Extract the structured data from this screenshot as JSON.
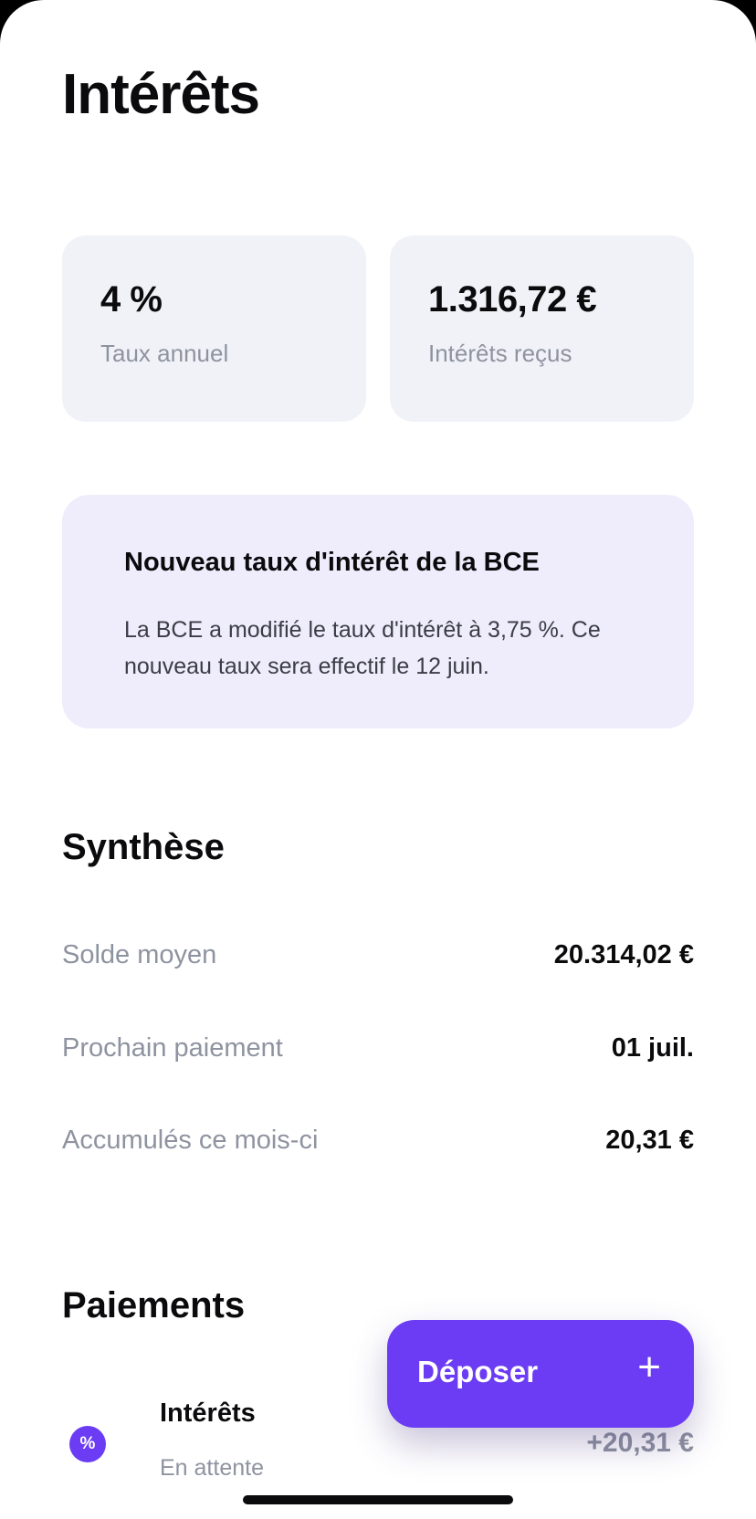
{
  "header": {
    "title": "Intérêts"
  },
  "stats": [
    {
      "value": "4 %",
      "label": "Taux annuel"
    },
    {
      "value": "1.316,72 €",
      "label": "Intérêts reçus"
    }
  ],
  "notice": {
    "title": "Nouveau taux d'intérêt de la BCE",
    "body": "La BCE a modifié le taux d'intérêt à 3,75 %. Ce nouveau taux sera effectif le 12 juin."
  },
  "summary": {
    "title": "Synthèse",
    "rows": [
      {
        "label": "Solde moyen",
        "value": "20.314,02 €"
      },
      {
        "label": "Prochain paiement",
        "value": "01 juil."
      },
      {
        "label": "Accumulés ce mois-ci",
        "value": "20,31 €"
      }
    ]
  },
  "payments": {
    "title": "Paiements",
    "items": [
      {
        "icon": "percent-icon",
        "icon_glyph": "%",
        "title": "Intérêts",
        "status": "En attente",
        "amount": "+20,31 €"
      }
    ]
  },
  "fab": {
    "label": "Déposer",
    "icon": "plus-icon",
    "icon_glyph": "+"
  },
  "colors": {
    "accent": "#6b3cf4",
    "card": "#f1f2f7",
    "notice": "#efecfc",
    "muted": "#8e93a0"
  }
}
